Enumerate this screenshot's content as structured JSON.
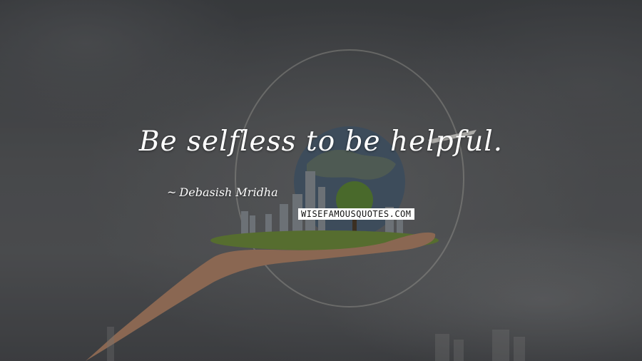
{
  "quote": {
    "text": "Be selfless to be helpful.",
    "author": "Debasish Mridha",
    "author_prefix": "~"
  },
  "watermark": {
    "text": "WISEFAMOUSQUOTES.COM"
  },
  "colors": {
    "text": "#ffffff",
    "grass": "#6f8f3a",
    "hand": "#b7876a"
  }
}
